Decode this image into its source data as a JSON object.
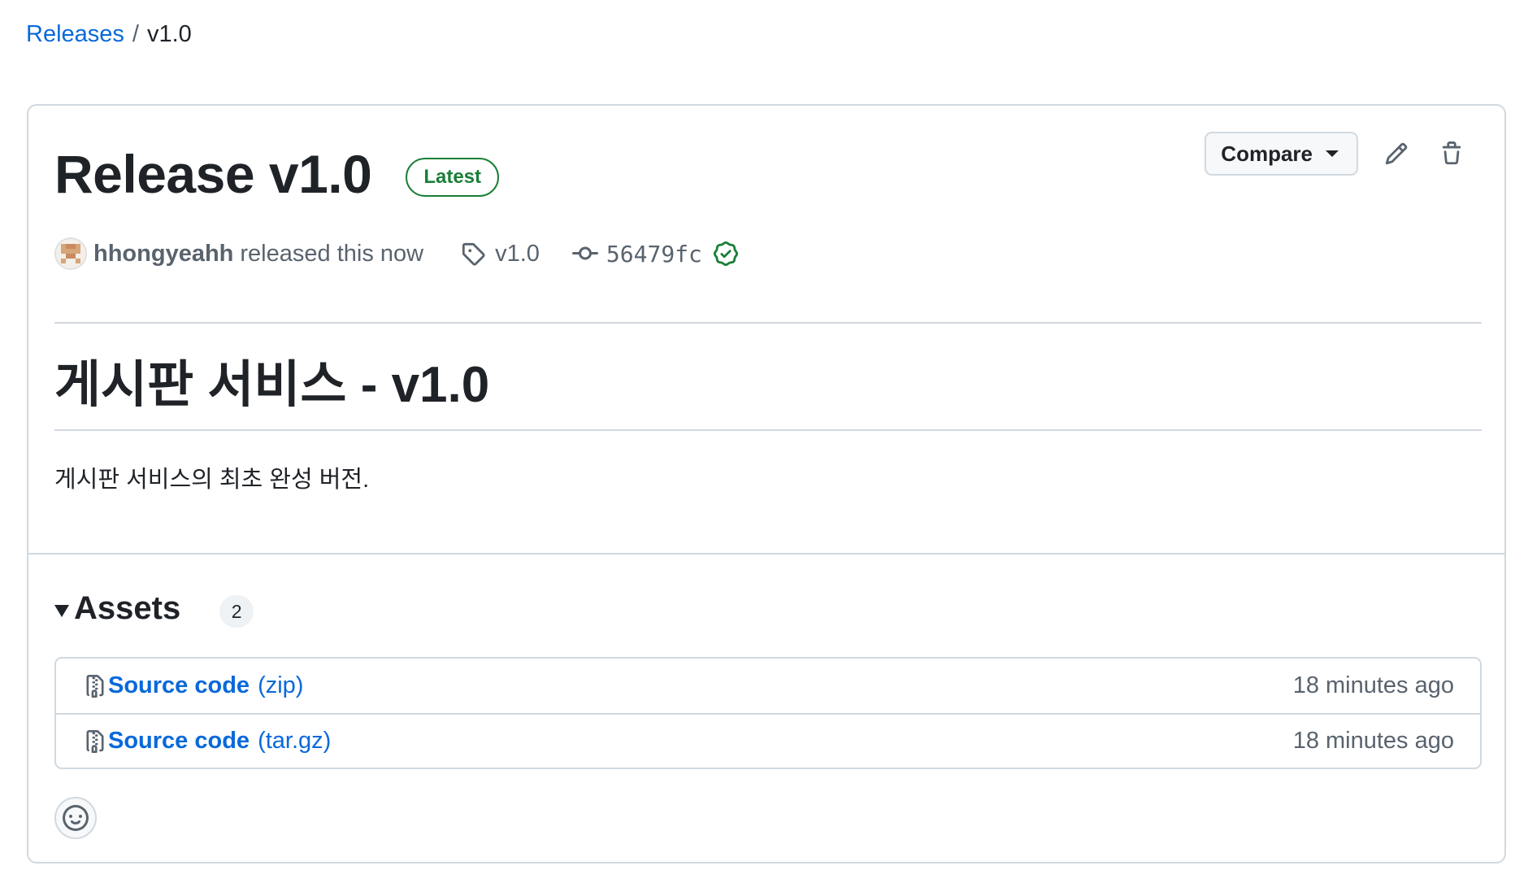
{
  "breadcrumb": {
    "root": "Releases",
    "separator": "/",
    "current": "v1.0"
  },
  "release": {
    "title": "Release v1.0",
    "badge": "Latest",
    "author": "hhongyeahh",
    "released_text": "released this now",
    "tag": "v1.0",
    "commit": "56479fc"
  },
  "actions": {
    "compare_label": "Compare",
    "edit_icon": "pencil-icon",
    "delete_icon": "trash-icon"
  },
  "notes": {
    "heading": "게시판 서비스 - v1.0",
    "body": "게시판 서비스의 최초 완성 버전."
  },
  "assets": {
    "title": "Assets",
    "count": "2",
    "items": [
      {
        "name": "Source code",
        "ext": "(zip)",
        "time": "18 minutes ago"
      },
      {
        "name": "Source code",
        "ext": "(tar.gz)",
        "time": "18 minutes ago"
      }
    ]
  },
  "colors": {
    "link": "#0969da",
    "success": "#1a7f37",
    "border": "#d1d9e0",
    "muted": "#59636e"
  }
}
